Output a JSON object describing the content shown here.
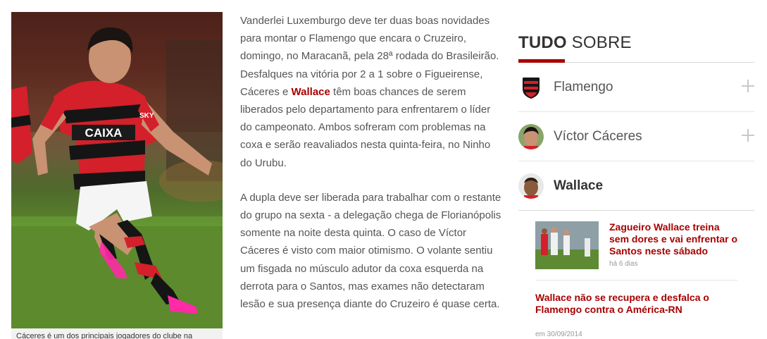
{
  "photo": {
    "caption": "Cáceres é um dos principais jogadores do clube na",
    "jersey_text": "CAIXA",
    "sleeve_text": "SKY",
    "colors": {
      "red": "#d4202a",
      "black": "#151515",
      "white": "#f5f5f5",
      "grass": "#5c8a2d"
    }
  },
  "article": {
    "p1_before": "Vanderlei Luxemburgo deve ter duas boas novidades para montar o Flamengo que encara o Cruzeiro, domingo, no Maracanã, pela 28ª rodada do Brasileirão. Desfalques na vitória por 2 a 1 sobre o Figueirense, Cáceres e ",
    "p1_link": "Wallace",
    "p1_after": " têm boas chances de serem liberados pelo departamento para enfrentarem o líder do campeonato. Ambos sofreram com problemas na coxa e serão reavaliados nesta quinta-feira, no Ninho do Urubu.",
    "p2": "A dupla deve ser liberada para trabalhar com o restante do grupo na sexta - a delegação chega de Florianópolis somente na noite desta quinta. O caso de Víctor Cáceres é visto com maior otimismo. O volante sentiu um fisgada no músculo adutor da coxa esquerda na derrota para o Santos, mas exames não detectaram lesão e sua presença diante do Cruzeiro é quase certa."
  },
  "sidebar": {
    "title_bold": "TUDO",
    "title_rest": " SOBRE",
    "accent": "#a80000",
    "topics": [
      {
        "label": "Flamengo",
        "icon": "flamengo-crest-icon"
      },
      {
        "label": "Víctor Cáceres",
        "icon": "avatar"
      },
      {
        "label": "Wallace",
        "icon": "avatar"
      }
    ],
    "news": [
      {
        "title": "Zagueiro Wallace treina sem dores e vai enfrentar o Santos neste sábado",
        "time": "há 6 dias"
      },
      {
        "title": "Wallace não se recupera e desfalca o Flamengo contra o América-RN",
        "time": "em 30/09/2014"
      }
    ]
  }
}
